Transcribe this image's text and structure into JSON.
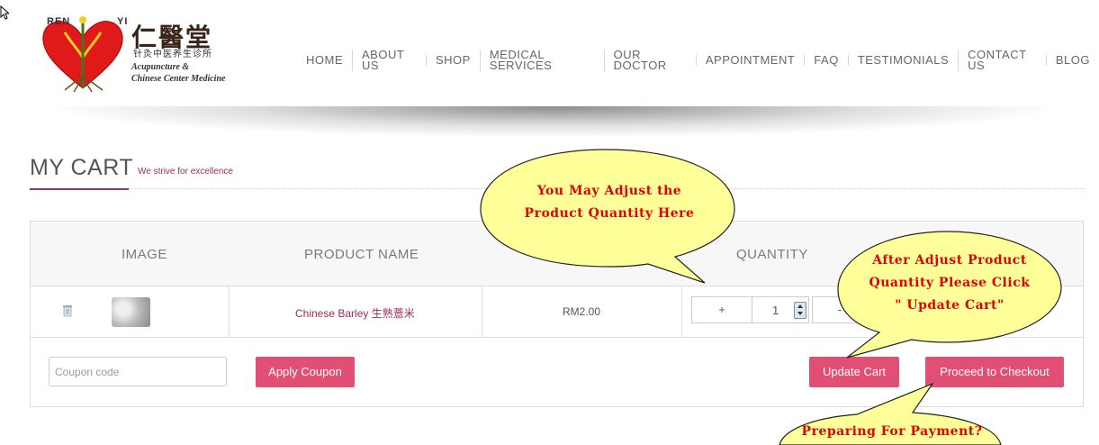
{
  "logo": {
    "left_text": "REN",
    "right_text": "YI",
    "chinese_name": "仁醫堂",
    "chinese_subtitle": "针灸中医养生诊所",
    "tagline_line1": "Acupuncture &",
    "tagline_line2": "Chinese Center Medicine"
  },
  "nav": {
    "items": [
      "HOME",
      "ABOUT US",
      "SHOP",
      "MEDICAL SERVICES",
      "OUR DOCTOR",
      "APPOINTMENT",
      "FAQ",
      "TESTIMONIALS",
      "CONTACT US",
      "BLOG"
    ]
  },
  "page": {
    "title": "MY CART",
    "subtitle": "We strive for excellence"
  },
  "cart": {
    "headers": {
      "image": "IMAGE",
      "name": "PRODUCT NAME",
      "quantity": "QUANTITY"
    },
    "item": {
      "name": "Chinese Barley 生熟薏米",
      "price": "RM2.00",
      "qty_plus": "+",
      "quantity": "1",
      "qty_minus": "-"
    },
    "coupon_placeholder": "Coupon code",
    "apply_coupon_label": "Apply Coupon",
    "update_cart_label": "Update Cart",
    "checkout_label": "Proceed to Checkout"
  },
  "callouts": {
    "adjust_quantity": [
      "You May Adjust the",
      "Product Quantity Here"
    ],
    "update_cart": [
      "After Adjust Product",
      "Quantity Please Click",
      "\" Update Cart\""
    ],
    "checkout": [
      "Preparing For Payment?"
    ]
  },
  "colors": {
    "accent": "#e24f74",
    "link": "#9c2c57",
    "callout_fill": "#ffff99",
    "callout_text": "#e00000"
  },
  "icons": [
    "cursor-icon",
    "heart-logo-icon",
    "remove-item-icon",
    "product-thumbnail",
    "quantity-spinner-icon"
  ]
}
